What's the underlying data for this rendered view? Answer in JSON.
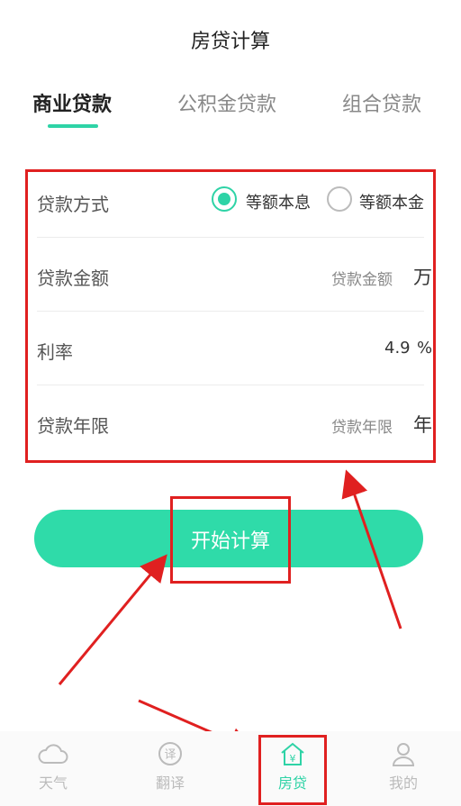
{
  "header": {
    "title": "房贷计算"
  },
  "tabs": [
    {
      "label": "商业贷款",
      "active": true
    },
    {
      "label": "公积金贷款",
      "active": false
    },
    {
      "label": "组合贷款",
      "active": false
    }
  ],
  "form": {
    "method": {
      "label": "贷款方式",
      "options": [
        "等额本息",
        "等额本金"
      ],
      "selected": "等额本息"
    },
    "amount": {
      "label": "贷款金额",
      "placeholder": "贷款金额",
      "unit": "万"
    },
    "rate": {
      "label": "利率",
      "value": "4.9",
      "unit": "%"
    },
    "years": {
      "label": "贷款年限",
      "placeholder": "贷款年限",
      "unit": "年"
    }
  },
  "calculate_button": {
    "label": "开始计算"
  },
  "bottom_nav": [
    {
      "label": "天气",
      "icon": "cloud-icon",
      "active": false
    },
    {
      "label": "翻译",
      "icon": "translate-icon",
      "active": false
    },
    {
      "label": "房贷",
      "icon": "house-yuan-icon",
      "active": true
    },
    {
      "label": "我的",
      "icon": "user-icon",
      "active": false
    }
  ],
  "colors": {
    "accent": "#2ed3a6",
    "annotation": "#e02020"
  }
}
